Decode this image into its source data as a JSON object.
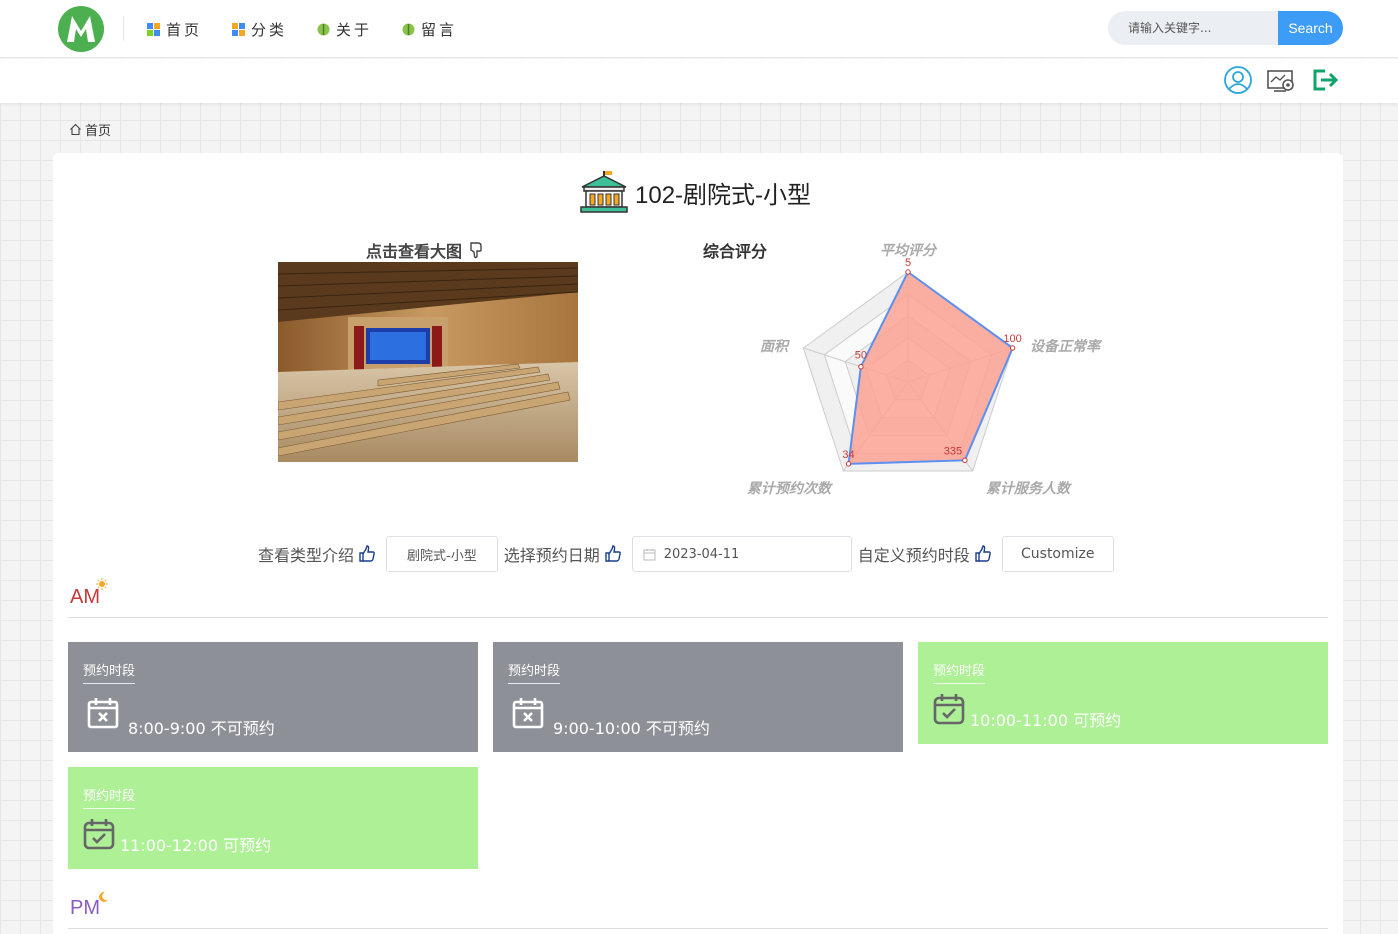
{
  "nav": {
    "items": [
      {
        "label": "首页",
        "icon": "grid-icon"
      },
      {
        "label": "分类",
        "icon": "category-icon"
      },
      {
        "label": "关于",
        "icon": "leaf-icon"
      },
      {
        "label": "留言",
        "icon": "leaf-icon"
      }
    ],
    "search": {
      "placeholder": "请输入关键字...",
      "button": "Search"
    }
  },
  "subbar": {
    "icons": [
      "user-icon",
      "settings-monitor-icon",
      "logout-icon"
    ]
  },
  "breadcrumb": {
    "home": "首页"
  },
  "room": {
    "title": "102-剧院式-小型",
    "image_title": "点击查看大图"
  },
  "radar": {
    "title": "综合评分",
    "colors": {
      "fill": "#fca293",
      "line": "#5b8ff0"
    }
  },
  "chart_data": {
    "type": "radar",
    "title": "综合评分",
    "indicators": [
      "平均评分",
      "设备正常率",
      "累计服务人数",
      "累计预约次数",
      "面积"
    ],
    "values": [
      5,
      100,
      335,
      34,
      50
    ]
  },
  "controls": {
    "type_label": "查看类型介绍",
    "type_value": "剧院式-小型",
    "date_label": "选择预约日期",
    "date_value": "2023-04-11",
    "custom_label": "自定义预约时段",
    "custom_button": "Customize"
  },
  "am": {
    "label": "AM",
    "slots": [
      {
        "head": "预约时段",
        "text": "8:00-9:00 不可预约",
        "status": "busy"
      },
      {
        "head": "预约时段",
        "text": "9:00-10:00 不可预约",
        "status": "busy"
      },
      {
        "head": "预约时段",
        "text": "10:00-11:00 可预约",
        "status": "free"
      },
      {
        "head": "预约时段",
        "text": "11:00-12:00 可预约",
        "status": "free"
      }
    ]
  },
  "pm": {
    "label": "PM"
  }
}
